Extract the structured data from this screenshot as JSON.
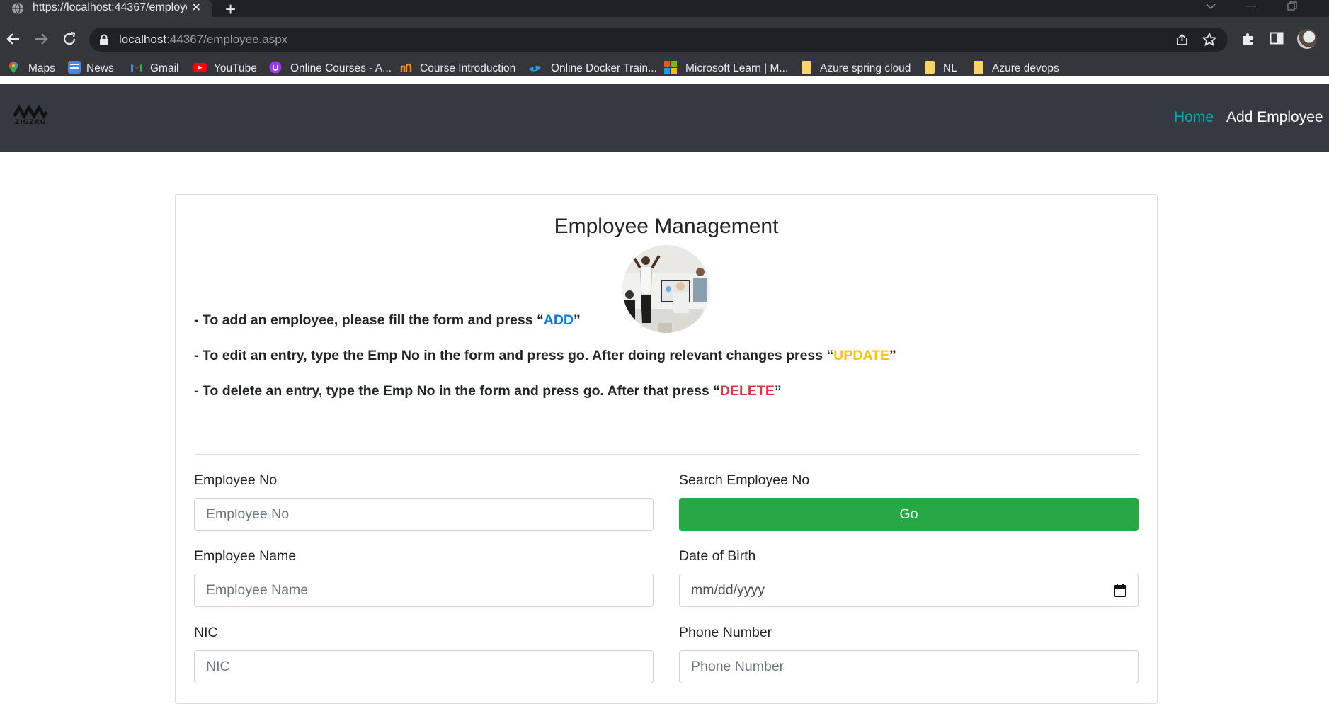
{
  "browser": {
    "tab_title": "https://localhost:44367/employee.aspx",
    "tab_close": "✕",
    "new_tab": "+",
    "url_host": "localhost",
    "url_rest": ":44367/employee.aspx"
  },
  "bookmarks": [
    {
      "label": "Maps",
      "icon": "maps-icon"
    },
    {
      "label": "News",
      "icon": "news-icon"
    },
    {
      "label": "Gmail",
      "icon": "gmail-icon"
    },
    {
      "label": "YouTube",
      "icon": "youtube-icon"
    },
    {
      "label": "Online Courses - A...",
      "icon": "udemy-icon"
    },
    {
      "label": "Course Introduction",
      "icon": "course-icon"
    },
    {
      "label": "Online Docker Train...",
      "icon": "docker-icon"
    },
    {
      "label": "Microsoft Learn | M...",
      "icon": "microsoft-icon"
    },
    {
      "label": "Azure spring cloud",
      "icon": "folder-icon"
    },
    {
      "label": "NL",
      "icon": "folder-icon"
    },
    {
      "label": "Azure devops",
      "icon": "folder-icon"
    }
  ],
  "site": {
    "logo_text": "ZIGZAG",
    "nav": {
      "home": "Home",
      "add_employee": "Add Employee"
    }
  },
  "page": {
    "title": "Employee Management",
    "instructions": {
      "add_prefix": "- To add an employee, please fill the form and press “",
      "add_kw": "ADD",
      "add_suffix": "”",
      "edit_prefix": "- To edit an entry, type the Emp No in the form and press go. After doing relevant changes press “",
      "edit_kw": "UPDATE",
      "edit_suffix": "”",
      "delete_prefix": "- To delete an entry, type the Emp No in the form and press go. After that press “",
      "delete_kw": "DELETE",
      "delete_suffix": "”"
    },
    "form": {
      "employee_no": {
        "label": "Employee No",
        "placeholder": "Employee No"
      },
      "search": {
        "label": "Search Employee No",
        "button": "Go"
      },
      "employee_name": {
        "label": "Employee Name",
        "placeholder": "Employee Name"
      },
      "dob": {
        "label": "Date of Birth",
        "placeholder": "mm/dd/yyyy"
      },
      "nic": {
        "label": "NIC",
        "placeholder": "NIC"
      },
      "phone": {
        "label": "Phone Number",
        "placeholder": "Phone Number"
      }
    }
  },
  "colors": {
    "navbar": "#343a40",
    "home_link": "#17a2b8",
    "add_kw": "#007bff",
    "update_kw": "#ffc107",
    "delete_kw": "#dc3545",
    "go_button": "#28a745"
  }
}
